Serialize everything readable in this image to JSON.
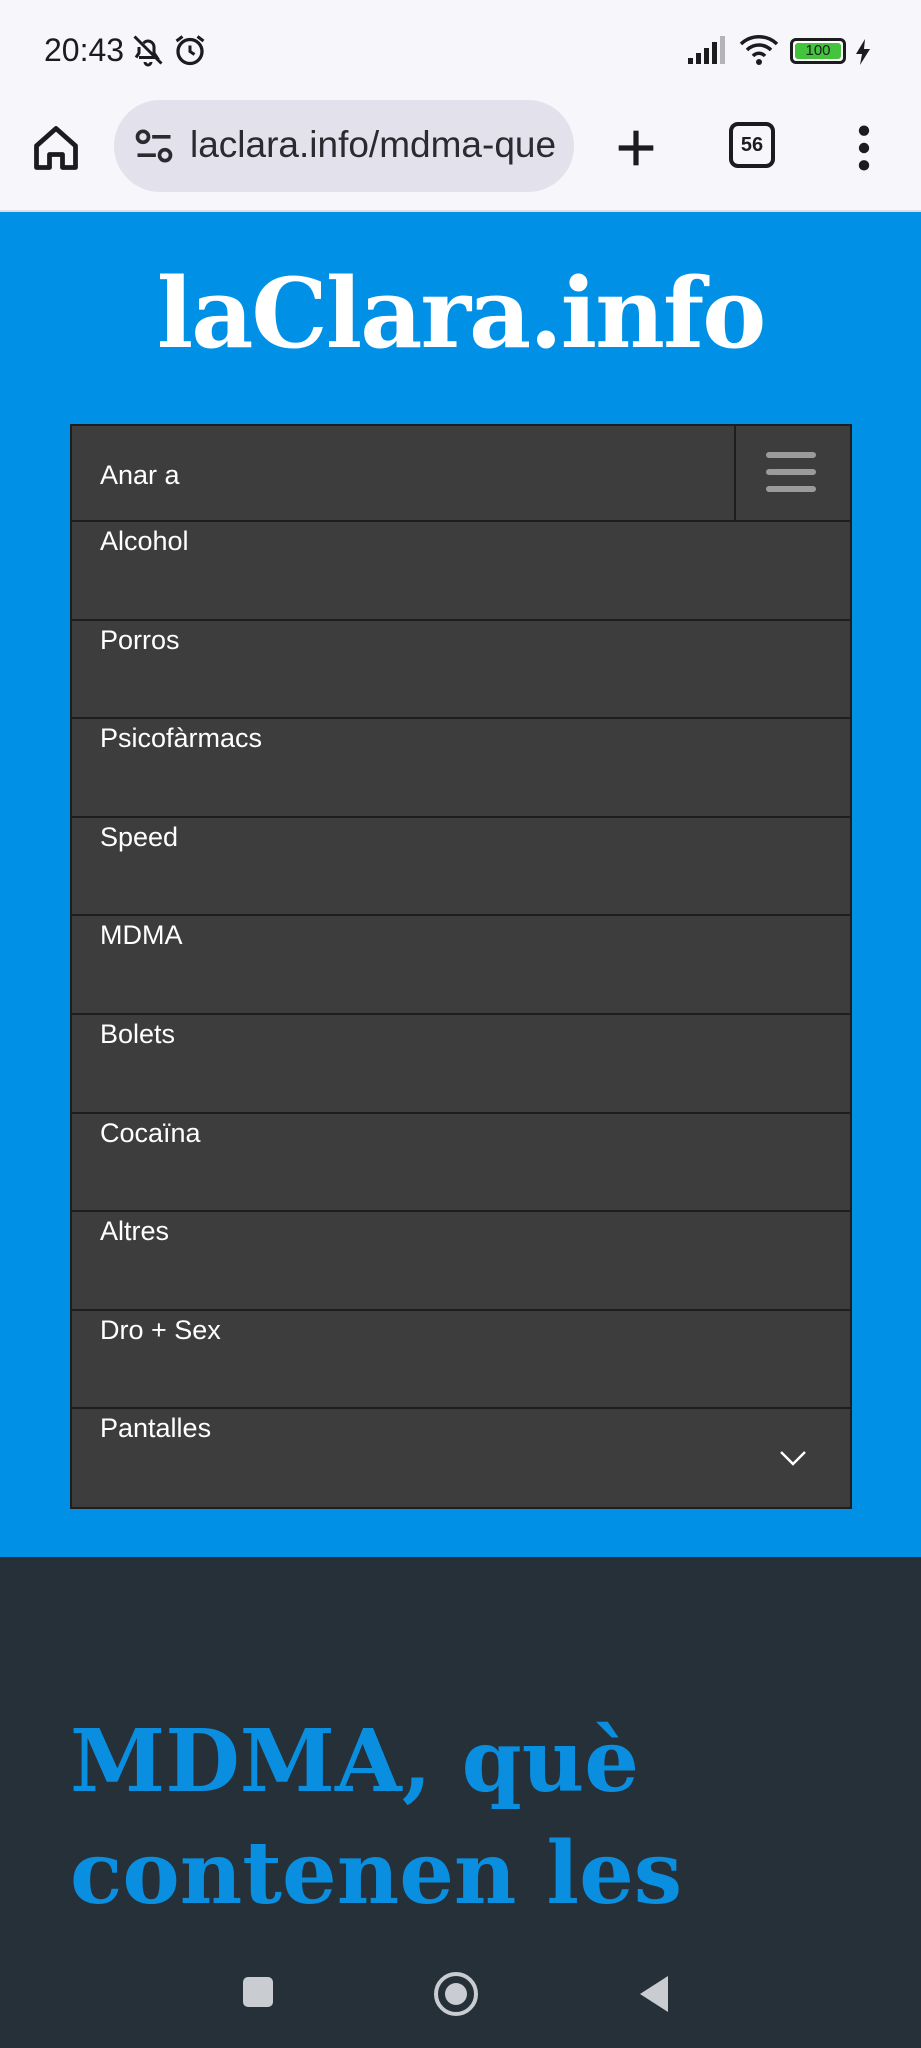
{
  "status_bar": {
    "time": "20:43",
    "icons": [
      "bell-off-icon",
      "alarm-icon",
      "signal-icon",
      "wifi-icon",
      "battery-icon",
      "charging-icon"
    ],
    "battery": "100"
  },
  "browser": {
    "url": "laclara.info/mdma-que",
    "tab_count": "56",
    "icons": [
      "home-icon",
      "site-settings-icon",
      "plus-icon",
      "more-vert-icon"
    ]
  },
  "site": {
    "logo": "laClara.info",
    "nav_heading": "Anar a",
    "nav_items": [
      "Alcohol",
      "Porros",
      "Psicofàrmacs",
      "Speed",
      "MDMA",
      "Bolets",
      "Cocaïna",
      "Altres",
      "Dro + Sex",
      "Pantalles"
    ]
  },
  "article": {
    "title": "MDMA, què contenen les pastilles d'èxtasi"
  },
  "colors": {
    "header_blue": "#0091e6",
    "nav_bg": "#3d3d3d",
    "article_bg": "#263038",
    "title_blue": "#0a8ee0"
  },
  "system_nav": {
    "icons": [
      "recents-square-icon",
      "home-circle-icon",
      "back-triangle-icon"
    ]
  }
}
